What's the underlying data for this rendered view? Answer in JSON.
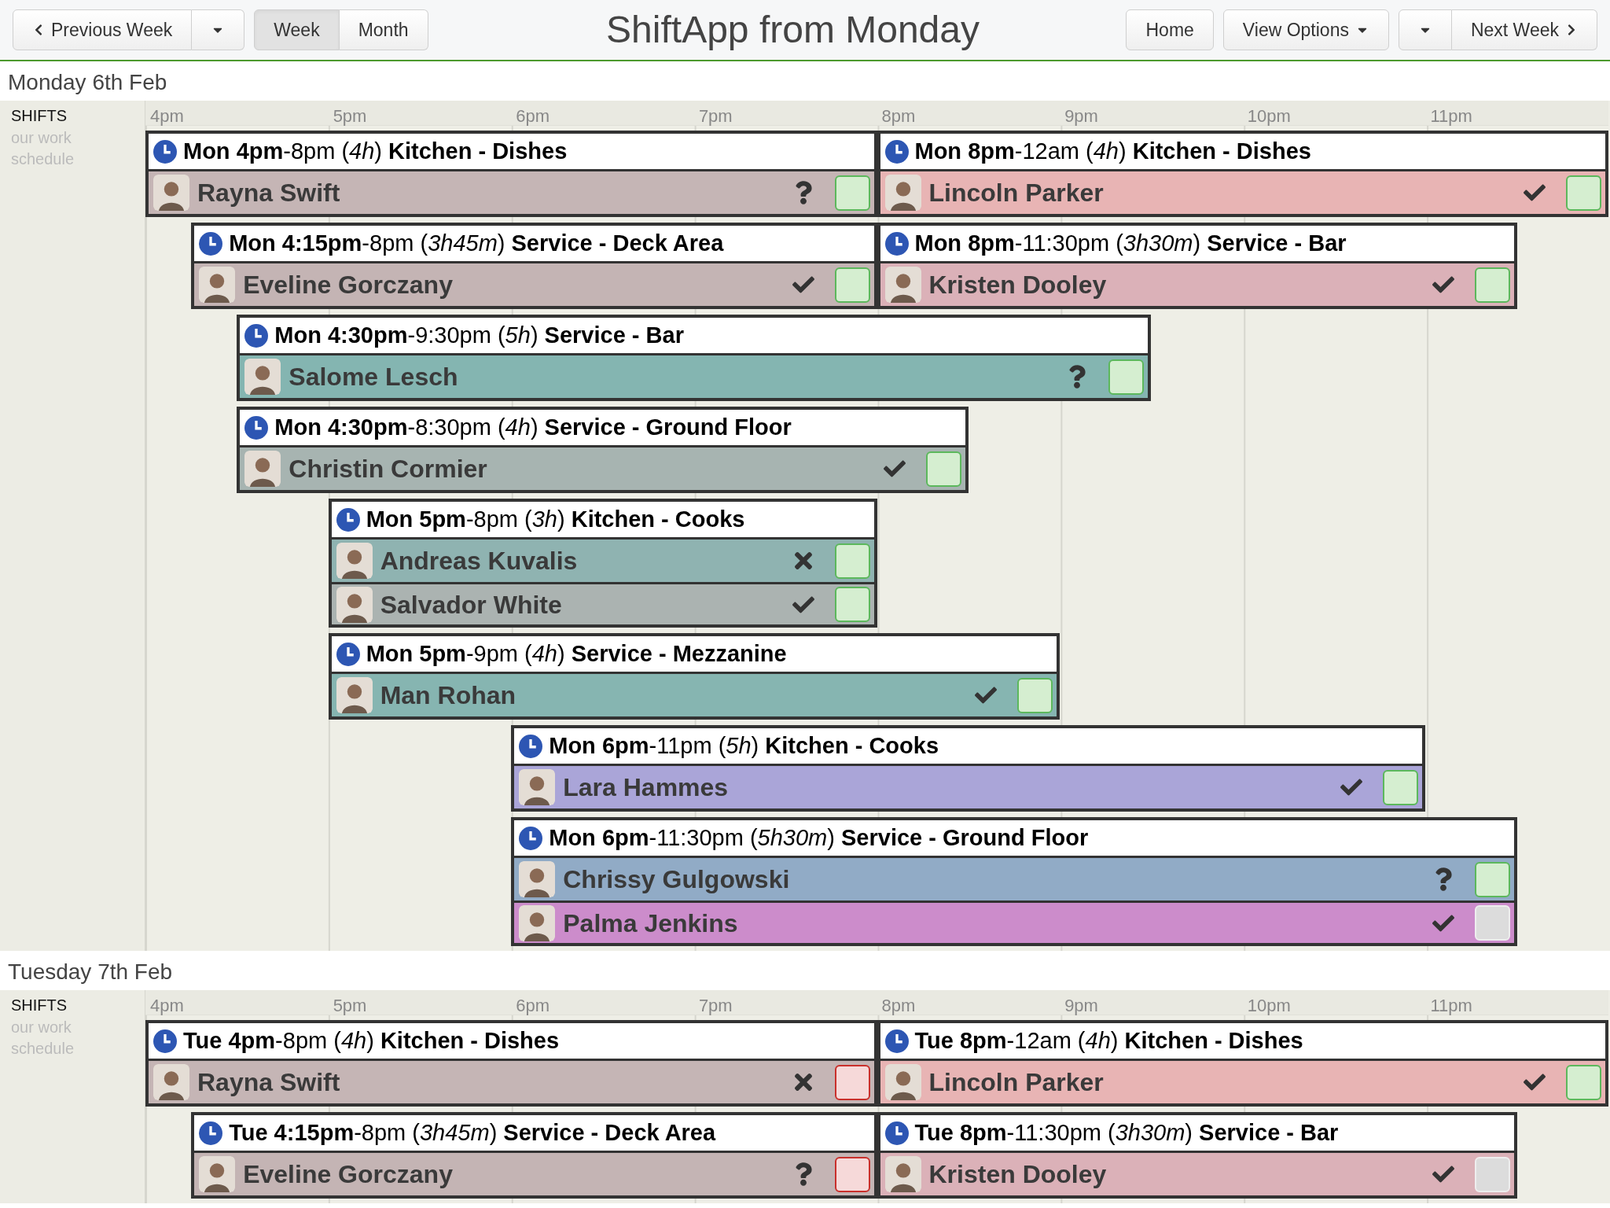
{
  "toolbar": {
    "previous": "Previous Week",
    "views": [
      {
        "label": "Week",
        "selected": true
      },
      {
        "label": "Month",
        "selected": false
      }
    ],
    "title": "ShiftApp from Monday",
    "home": "Home",
    "view_options": "View Options",
    "next": "Next Week"
  },
  "days": [
    {
      "title": "Monday 6th Feb",
      "label": "SHIFTS",
      "sublabel": "our work schedule",
      "hours": [
        "4pm",
        "5pm",
        "6pm",
        "7pm",
        "8pm",
        "9pm",
        "10pm",
        "11pm"
      ],
      "lanes": [
        {
          "shifts": [
            {
              "heading": "**Mon 4pm**-8pm (*4h*) **Kitchen - Dishes**",
              "people": [
                {
                  "name": "Rayna Swift",
                  "color": "#c5b5b5",
                  "accepted": false,
                  "declined": false,
                  "approved": true,
                  "flagged": false
                }
              ]
            },
            {
              "heading": "**Mon 8pm**-12am (*4h*) **Kitchen - Dishes**",
              "people": [
                {
                  "name": "Lincoln Parker",
                  "color": "#e8b4b4",
                  "accepted": true,
                  "declined": false,
                  "approved": true,
                  "flagged": false
                }
              ]
            }
          ]
        },
        {
          "shifts": [
            {
              "heading": "**Mon 4:15pm**-8pm (*3h45m*) **Service - Deck Area**",
              "people": [
                {
                  "name": "Eveline Gorczany",
                  "color": "#c4b4b4",
                  "accepted": true,
                  "declined": false,
                  "approved": true,
                  "flagged": false
                }
              ]
            },
            {
              "heading": "**Mon 8pm**-11:30pm (*3h30m*) **Service - Bar**",
              "people": [
                {
                  "name": "Kristen Dooley",
                  "color": "#dbb1b8",
                  "accepted": true,
                  "declined": false,
                  "approved": true,
                  "flagged": false
                }
              ]
            }
          ]
        },
        {
          "shifts": [
            {
              "heading": "**Mon 4:30pm**-9:30pm (*5h*) **Service - Bar**",
              "people": [
                {
                  "name": "Salome Lesch",
                  "color": "#84b5b1",
                  "accepted": false,
                  "declined": false,
                  "approved": true,
                  "flagged": false
                }
              ]
            }
          ]
        },
        {
          "shifts": [
            {
              "heading": "**Mon 4:30pm**-8:30pm (*4h*) **Service - Ground Floor**",
              "people": [
                {
                  "name": "Christin Cormier",
                  "color": "#a7b4b1",
                  "accepted": true,
                  "declined": false,
                  "approved": true,
                  "flagged": false
                }
              ]
            }
          ]
        },
        {
          "shifts": [
            {
              "heading": "**Mon 5pm**-8pm (*3h*) **Kitchen - Cooks**",
              "people": [
                {
                  "name": "Andreas Kuvalis",
                  "color": "#8fb3b1",
                  "accepted": false,
                  "declined": true,
                  "approved": true,
                  "flagged": false
                },
                {
                  "name": "Salvador White",
                  "color": "#abb3b1",
                  "accepted": true,
                  "declined": false,
                  "approved": true,
                  "flagged": false
                }
              ]
            }
          ]
        },
        {
          "shifts": [
            {
              "heading": "**Mon 5pm**-9pm (*4h*) **Service - Mezzanine**",
              "people": [
                {
                  "name": "Man Rohan",
                  "color": "#86b5b1",
                  "accepted": true,
                  "declined": false,
                  "approved": true,
                  "flagged": false
                }
              ]
            }
          ]
        },
        {
          "shifts": [
            {
              "heading": "**Mon 6pm**-11pm (*5h*) **Kitchen - Cooks**",
              "people": [
                {
                  "name": "Lara Hammes",
                  "color": "#aaa5d8",
                  "accepted": true,
                  "declined": false,
                  "approved": true,
                  "flagged": false
                }
              ]
            }
          ]
        },
        {
          "shifts": [
            {
              "heading": "**Mon 6pm**-11:30pm (*5h30m*) **Service - Ground Floor**",
              "people": [
                {
                  "name": "Chrissy Gulgowski",
                  "color": "#91abc6",
                  "accepted": false,
                  "declined": false,
                  "approved": true,
                  "flagged": false
                },
                {
                  "name": "Palma Jenkins",
                  "color": "#cc8ccb",
                  "accepted": true,
                  "declined": false,
                  "approved": false,
                  "flagged": false
                }
              ]
            }
          ]
        }
      ]
    },
    {
      "title": "Tuesday 7th Feb",
      "label": "SHIFTS",
      "sublabel": "our work schedule",
      "hours": [
        "4pm",
        "5pm",
        "6pm",
        "7pm",
        "8pm",
        "9pm",
        "10pm",
        "11pm"
      ],
      "lanes": [
        {
          "shifts": [
            {
              "heading": "**Tue 4pm**-8pm (*4h*) **Kitchen - Dishes**",
              "people": [
                {
                  "name": "Rayna Swift",
                  "color": "#c5b5b5",
                  "accepted": false,
                  "declined": true,
                  "approved": false,
                  "flagged": true
                }
              ]
            },
            {
              "heading": "**Tue 8pm**-12am (*4h*) **Kitchen - Dishes**",
              "people": [
                {
                  "name": "Lincoln Parker",
                  "color": "#e8b4b4",
                  "accepted": true,
                  "declined": false,
                  "approved": true,
                  "flagged": false
                }
              ]
            }
          ]
        },
        {
          "shifts": [
            {
              "heading": "**Tue 4:15pm**-8pm (*3h45m*) **Service - Deck Area**",
              "people": [
                {
                  "name": "Eveline Gorczany",
                  "color": "#c4b4b4",
                  "accepted": false,
                  "declined": false,
                  "approved": false,
                  "flagged": true
                }
              ]
            },
            {
              "heading": "**Tue 8pm**-11:30pm (*3h30m*) **Service - Bar**",
              "people": [
                {
                  "name": "Kristen Dooley",
                  "color": "#dbb1b8",
                  "accepted": true,
                  "declined": false,
                  "approved": false,
                  "flagged": false
                }
              ]
            }
          ]
        }
      ]
    }
  ]
}
